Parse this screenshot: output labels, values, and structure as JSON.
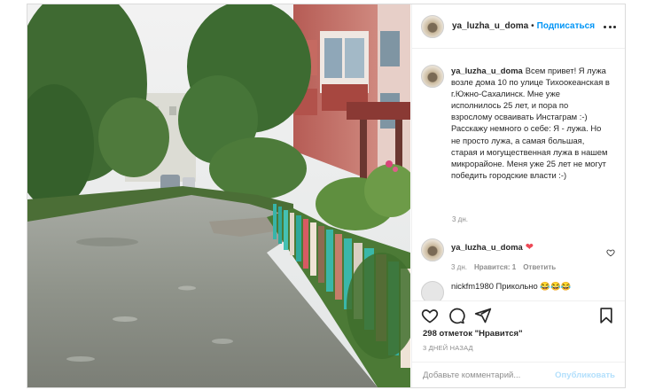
{
  "post": {
    "username": "ya_luzha_u_doma",
    "separator": "•",
    "follow_label": "Подписаться",
    "caption": "Всем привет! Я лужа возле дома 10 по улице Тихоокеанская в г.Южно-Сахалинск. Мне уже исполнилось 25 лет, и пора по взрослому осваивать Инстаграм :-)\nРасскажу немного о себе: Я - лужа. Но не просто лужа, а самая большая, старая и могущественная лужа в нашем микрорайоне. Меня уже 25 лет не могут победить городские власти :-)",
    "caption_age": "3 дн.",
    "reply": {
      "username": "ya_luzha_u_doma",
      "emoji": "❤",
      "age": "3 дн.",
      "likes_label": "Нравится: 1",
      "reply_label": "Ответить"
    },
    "next_comment": {
      "text": "nickfm1980 Прикольно 😂😂😂"
    },
    "likes_text": "298 отметок \"Нравится\"",
    "date_text": "3 ДНЕЙ НАЗАД",
    "comment_placeholder": "Добавьте комментарий...",
    "publish_label": "Опубликовать"
  },
  "icons": {
    "more": "more-options-icon",
    "like": "heart-icon",
    "comment": "comment-icon",
    "share": "share-icon",
    "save": "bookmark-icon"
  },
  "colors": {
    "accent": "#0095f6",
    "publish_disabled": "#b2dffc",
    "heart": "#ed4956",
    "muted": "#8e8e8e"
  }
}
